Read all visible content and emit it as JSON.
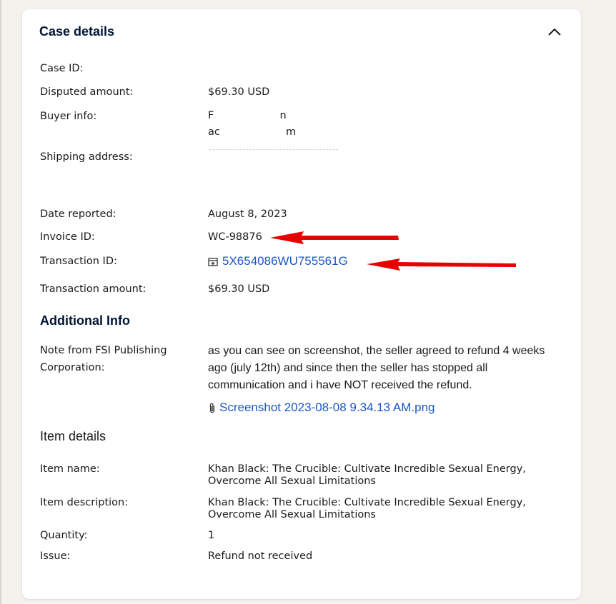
{
  "card": {
    "title": "Case details"
  },
  "details": {
    "case_id_label": "Case ID:",
    "case_id_value": "",
    "disputed_amount_label": "Disputed amount:",
    "disputed_amount_value": "$69.30 USD",
    "buyer_info_label": "Buyer info:",
    "buyer_name_visible": "F                    n",
    "buyer_email_visible": "ac                    m",
    "shipping_address_label": "Shipping address:",
    "date_reported_label": "Date reported:",
    "date_reported_value": "August 8, 2023",
    "invoice_id_label": "Invoice ID:",
    "invoice_id_value": "WC-98876",
    "transaction_id_label": "Transaction ID:",
    "transaction_id_value": "5X654086WU755561G",
    "transaction_amount_label": "Transaction amount:",
    "transaction_amount_value": "$69.30 USD"
  },
  "additional_info": {
    "heading": "Additional Info",
    "note_label_line1": "Note from FSI Publishing",
    "note_label_line2": "Corporation:",
    "note_text": "as you can see on screenshot, the seller agreed to refund 4 weeks ago (july 12th) and since then the seller has stopped all communication and i have NOT received the refund.",
    "attachment_name": "Screenshot 2023-08-08 9.34.13 AM.png"
  },
  "item_details": {
    "heading": "Item details",
    "item_name_label": "Item name:",
    "item_name_line1": "Khan Black: The Crucible: Cultivate Incredible Sexual Energy,",
    "item_name_line2": "Overcome All Sexual Limitations",
    "item_description_label": "Item description:",
    "item_description_line1": "Khan Black: The Crucible: Cultivate Incredible Sexual Energy,",
    "item_description_line2": "Overcome All Sexual Limitations",
    "quantity_label": "Quantity:",
    "quantity_value": "1",
    "issue_label": "Issue:",
    "issue_value": "Refund not received"
  },
  "colors": {
    "link": "#1a56c9",
    "heading": "#001435",
    "annotation_arrow": "#e60000",
    "page_background": "#f5f2ee"
  },
  "icons": {
    "collapse": "chevron-up-icon",
    "transaction_link": "external-link-icon",
    "attachment": "paperclip-icon"
  }
}
